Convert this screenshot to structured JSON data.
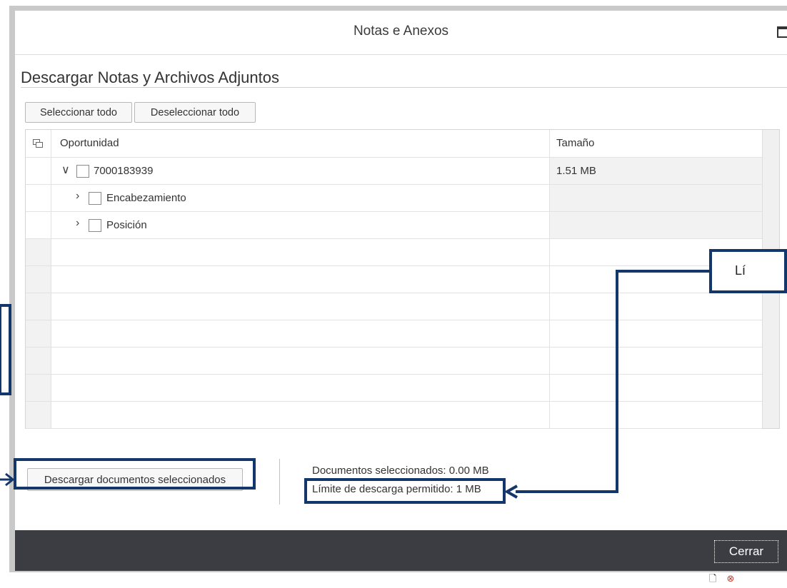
{
  "dialog": {
    "title": "Notas e Anexos",
    "section_title": "Descargar Notas y Archivos Adjuntos"
  },
  "toolbar": {
    "select_all_label": "Seleccionar todo",
    "deselect_all_label": "Deseleccionar todo"
  },
  "table": {
    "columns": [
      "Oportunidad",
      "Tamaño"
    ],
    "rows": [
      {
        "label": "7000183939",
        "size": "1.51 MB",
        "expanded": true,
        "checked": false
      },
      {
        "label": "Encabezamiento",
        "size": "",
        "expanded": false,
        "checked": false
      },
      {
        "label": "Posición",
        "size": "",
        "expanded": false,
        "checked": false
      }
    ],
    "empty_rows": 7
  },
  "footer": {
    "download_label": "Descargar documentos seleccionados",
    "selected_docs": "Documentos seleccionados: 0.00 MB",
    "download_limit": "Límite de descarga permitido: 1 MB"
  },
  "bottom_bar": {
    "close_label": "Cerrar"
  },
  "annotations": {
    "callout_text": "Lí"
  },
  "colors": {
    "annotation_blue": "#14376b",
    "bottom_bar": "#3b3d42",
    "frame_grey": "#c9c9c9"
  },
  "icons": [
    "maximize-icon",
    "column-settings-icon",
    "chevron-down-icon",
    "chevron-right-icon",
    "checkbox",
    "document-icon",
    "error-icon"
  ]
}
